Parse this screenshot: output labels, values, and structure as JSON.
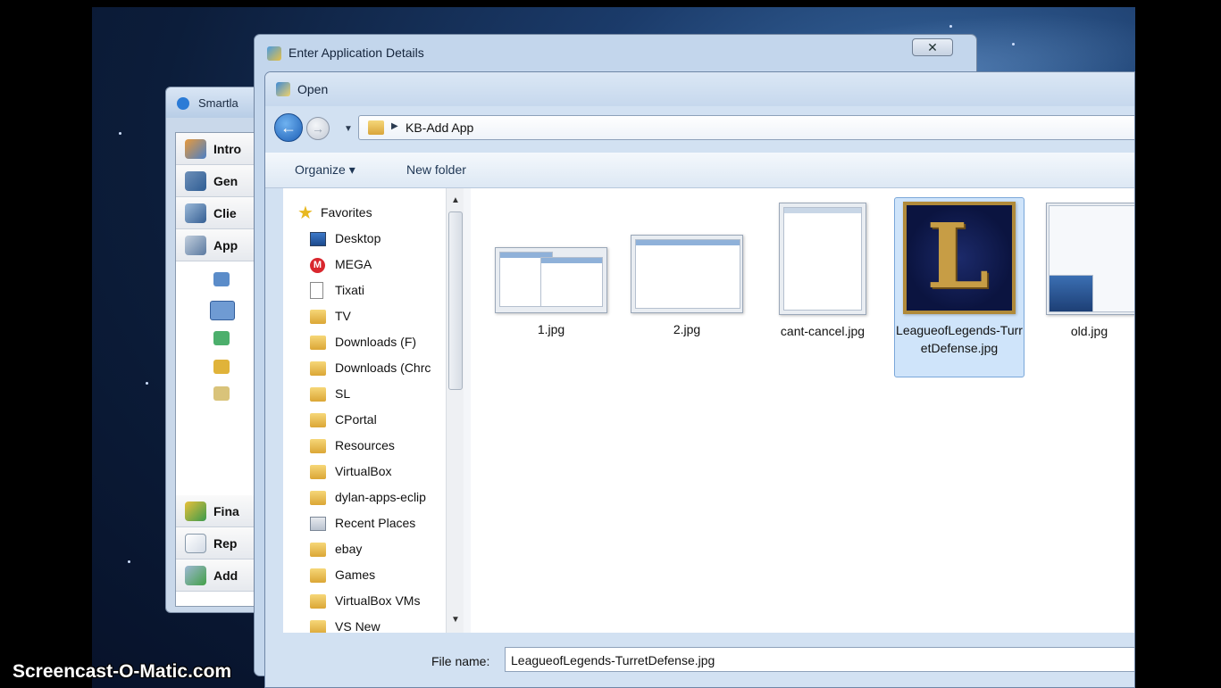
{
  "desktop": {
    "watermark": "Screencast-O-Matic.com"
  },
  "smartlaunch": {
    "title": "Smartla",
    "nav": [
      "Intro",
      "Gen",
      "Clie",
      "App"
    ],
    "bottom_nav": [
      "Fina",
      "Rep",
      "Add"
    ]
  },
  "details_window": {
    "title": "Enter Application Details",
    "close_glyph": "✕"
  },
  "open_dialog": {
    "title": "Open",
    "path": "KB-Add App",
    "organize_label": "Organize ▾",
    "new_folder_label": "New folder",
    "nav_items": [
      {
        "label": "Favorites",
        "icon": "star-icon"
      },
      {
        "label": "Desktop",
        "icon": "desktop-icon"
      },
      {
        "label": "MEGA",
        "icon": "mega-icon"
      },
      {
        "label": "Tixati",
        "icon": "document-icon"
      },
      {
        "label": "TV",
        "icon": "folder-icon"
      },
      {
        "label": "Downloads (F)",
        "icon": "folder-icon"
      },
      {
        "label": "Downloads (Chrc",
        "icon": "folder-icon"
      },
      {
        "label": "SL",
        "icon": "folder-icon"
      },
      {
        "label": "CPortal",
        "icon": "folder-icon"
      },
      {
        "label": "Resources",
        "icon": "folder-icon"
      },
      {
        "label": "VirtualBox",
        "icon": "folder-icon"
      },
      {
        "label": "dylan-apps-eclip",
        "icon": "folder-icon"
      },
      {
        "label": "Recent Places",
        "icon": "recent-places-icon"
      },
      {
        "label": "ebay",
        "icon": "folder-icon"
      },
      {
        "label": "Games",
        "icon": "folder-icon"
      },
      {
        "label": "VirtualBox VMs",
        "icon": "folder-icon"
      },
      {
        "label": "VS New",
        "icon": "folder-icon"
      }
    ],
    "files": [
      {
        "name": "1.jpg"
      },
      {
        "name": "2.jpg"
      },
      {
        "name": "cant-cancel.jpg"
      },
      {
        "name": "LeagueofLegends-TurretDefense.jpg",
        "selected": true
      },
      {
        "name": "old.jpg"
      }
    ],
    "file_name_label": "File name:",
    "file_name_value": "LeagueofLegends-TurretDefense.jpg"
  }
}
